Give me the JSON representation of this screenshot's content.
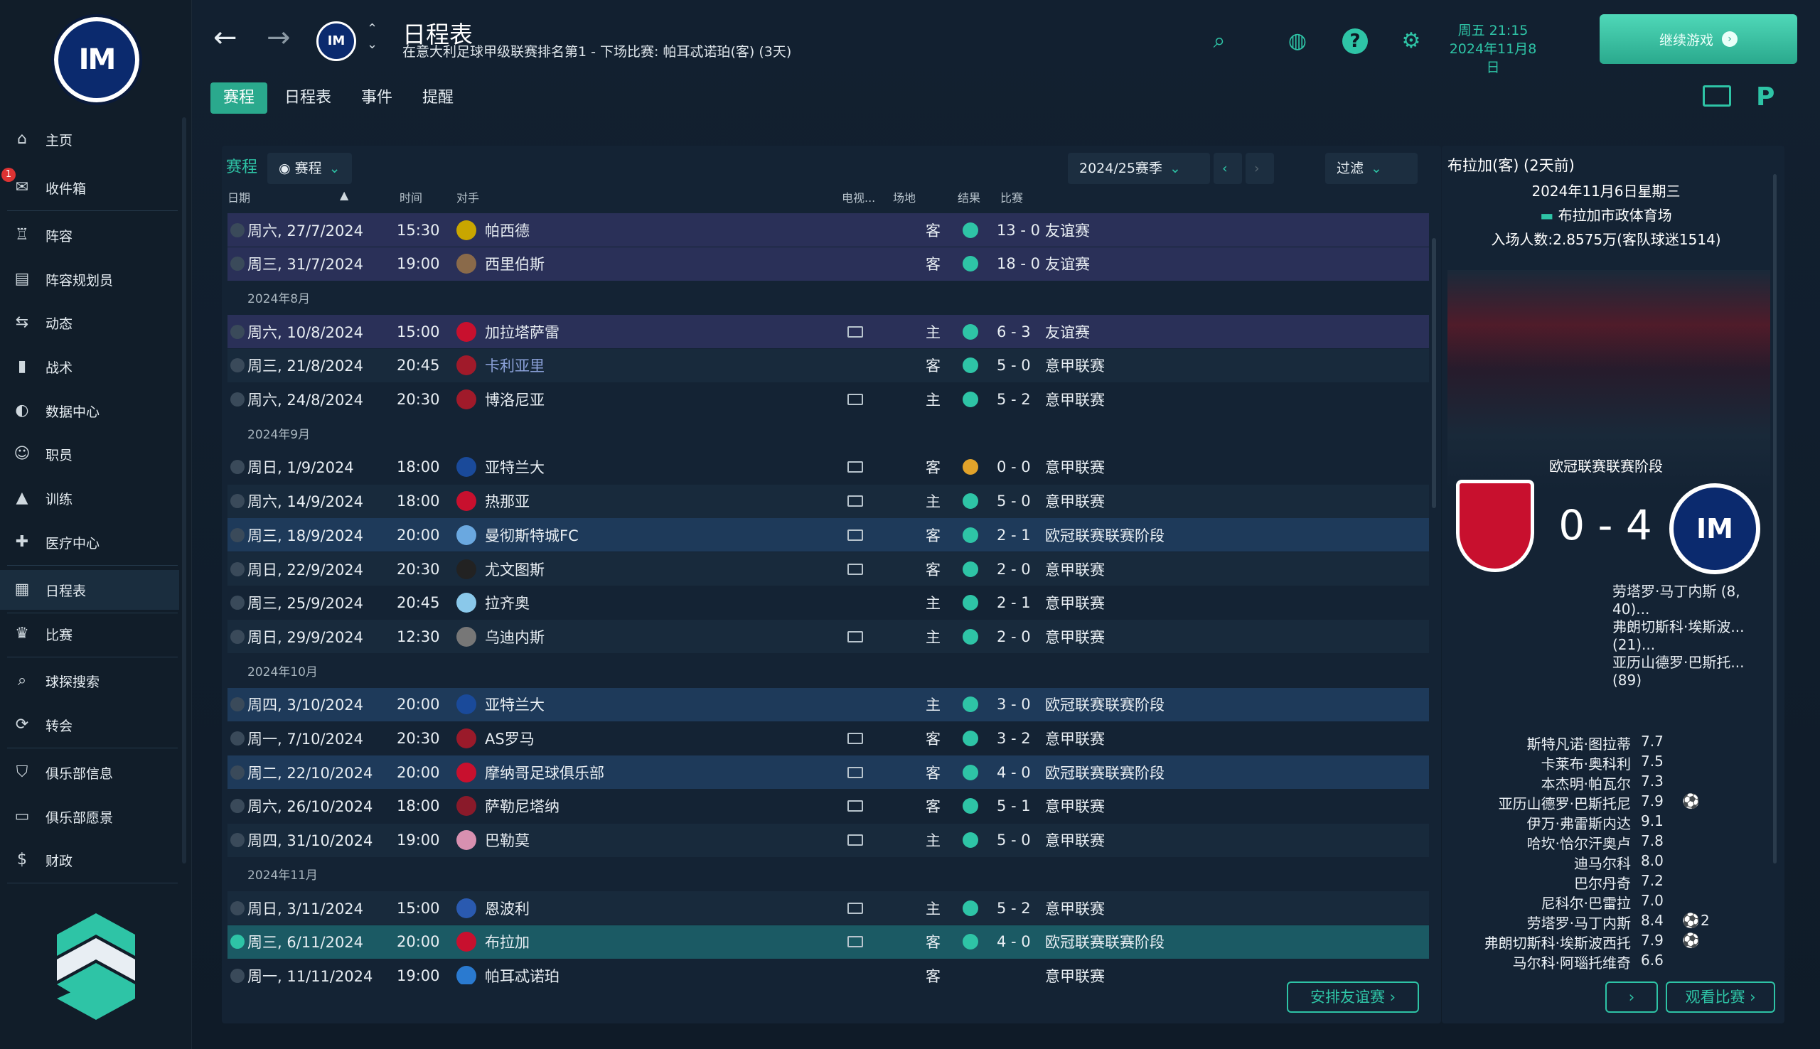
{
  "sidebar": {
    "items": [
      {
        "label": "主页",
        "icon": "home-icon"
      },
      {
        "label": "收件箱",
        "icon": "inbox-icon",
        "badge": "1"
      },
      {
        "label": "阵容",
        "icon": "shirt-icon"
      },
      {
        "label": "阵容规划员",
        "icon": "clipboard-icon"
      },
      {
        "label": "动态",
        "icon": "dynamics-icon"
      },
      {
        "label": "战术",
        "icon": "tactics-icon"
      },
      {
        "label": "数据中心",
        "icon": "data-hub-icon"
      },
      {
        "label": "职员",
        "icon": "staff-icon"
      },
      {
        "label": "训练",
        "icon": "training-icon"
      },
      {
        "label": "医疗中心",
        "icon": "medical-icon"
      },
      {
        "label": "日程表",
        "icon": "calendar-icon"
      },
      {
        "label": "比赛",
        "icon": "trophy-icon"
      },
      {
        "label": "球探搜索",
        "icon": "scouting-icon"
      },
      {
        "label": "转会",
        "icon": "transfers-icon"
      },
      {
        "label": "俱乐部信息",
        "icon": "club-info-icon"
      },
      {
        "label": "俱乐部愿景",
        "icon": "club-vision-icon"
      },
      {
        "label": "财政",
        "icon": "finances-icon"
      }
    ]
  },
  "header": {
    "title": "日程表",
    "subtitle": "在意大利足球甲级联赛排名第1 - 下场比赛: 帕耳忒诺珀(客) (3天)",
    "date_day": "周五 21:15",
    "date_full": "2024年11月8日",
    "continue_label": "继续游戏"
  },
  "tabs": [
    "赛程",
    "日程表",
    "事件",
    "提醒"
  ],
  "panel": {
    "title": "赛程",
    "view_dropdown": "赛程",
    "season": "2024/25赛季",
    "filter": "过滤",
    "columns": {
      "date": "日期",
      "time": "时间",
      "opponent": "对手",
      "tv": "电视...",
      "venue": "场地",
      "result": "结果",
      "competition": "比赛"
    },
    "arrange_friendly": "安排友谊赛"
  },
  "fixtures": [
    {
      "type": "match",
      "date": "周六, 27/7/2024",
      "time": "15:30",
      "opp": "帕西德",
      "tv": false,
      "venue": "客",
      "res": "w",
      "score": "13 - 0",
      "comp": "友谊赛",
      "style": "hl1",
      "color": "#c9a600"
    },
    {
      "type": "match",
      "date": "周三, 31/7/2024",
      "time": "19:00",
      "opp": "西里伯斯",
      "tv": false,
      "venue": "客",
      "res": "w",
      "score": "18 - 0",
      "comp": "友谊赛",
      "style": "hl1",
      "color": "#8a6a4a"
    },
    {
      "type": "month",
      "label": "2024年8月"
    },
    {
      "type": "match",
      "date": "周六, 10/8/2024",
      "time": "15:00",
      "opp": "加拉塔萨雷",
      "tv": true,
      "venue": "主",
      "res": "w",
      "score": "6 - 3",
      "comp": "友谊赛",
      "style": "hl1",
      "color": "#c8102e"
    },
    {
      "type": "match",
      "date": "周三, 21/8/2024",
      "time": "20:45",
      "opp": "卡利亚里",
      "tv": false,
      "venue": "客",
      "res": "w",
      "score": "5 - 0",
      "comp": "意甲联赛",
      "style": "alt",
      "color": "#a01a2a",
      "link": true
    },
    {
      "type": "match",
      "date": "周六, 24/8/2024",
      "time": "20:30",
      "opp": "博洛尼亚",
      "tv": true,
      "venue": "主",
      "res": "w",
      "score": "5 - 2",
      "comp": "意甲联赛",
      "style": "",
      "color": "#a01a2a"
    },
    {
      "type": "month",
      "label": "2024年9月"
    },
    {
      "type": "match",
      "date": "周日, 1/9/2024",
      "time": "18:00",
      "opp": "亚特兰大",
      "tv": true,
      "venue": "客",
      "res": "d",
      "score": "0 - 0",
      "comp": "意甲联赛",
      "style": "",
      "color": "#1a4a9a"
    },
    {
      "type": "match",
      "date": "周六, 14/9/2024",
      "time": "18:00",
      "opp": "热那亚",
      "tv": true,
      "venue": "主",
      "res": "w",
      "score": "5 - 0",
      "comp": "意甲联赛",
      "style": "alt",
      "color": "#c8102e"
    },
    {
      "type": "match",
      "date": "周三, 18/9/2024",
      "time": "20:00",
      "opp": "曼彻斯特城FC",
      "tv": true,
      "venue": "客",
      "res": "w",
      "score": "2 - 1",
      "comp": "欧冠联赛联赛阶段",
      "style": "hl2",
      "color": "#6aa8e0"
    },
    {
      "type": "match",
      "date": "周日, 22/9/2024",
      "time": "20:30",
      "opp": "尤文图斯",
      "tv": true,
      "venue": "客",
      "res": "w",
      "score": "2 - 0",
      "comp": "意甲联赛",
      "style": "alt",
      "color": "#222222"
    },
    {
      "type": "match",
      "date": "周三, 25/9/2024",
      "time": "20:45",
      "opp": "拉齐奥",
      "tv": false,
      "venue": "主",
      "res": "w",
      "score": "2 - 1",
      "comp": "意甲联赛",
      "style": "",
      "color": "#8ac8ea"
    },
    {
      "type": "match",
      "date": "周日, 29/9/2024",
      "time": "12:30",
      "opp": "乌迪内斯",
      "tv": true,
      "venue": "主",
      "res": "w",
      "score": "2 - 0",
      "comp": "意甲联赛",
      "style": "alt",
      "color": "#777777"
    },
    {
      "type": "month",
      "label": "2024年10月"
    },
    {
      "type": "match",
      "date": "周四, 3/10/2024",
      "time": "20:00",
      "opp": "亚特兰大",
      "tv": false,
      "venue": "主",
      "res": "w",
      "score": "3 - 0",
      "comp": "欧冠联赛联赛阶段",
      "style": "hl2",
      "color": "#1a4a9a"
    },
    {
      "type": "match",
      "date": "周一, 7/10/2024",
      "time": "20:30",
      "opp": "AS罗马",
      "tv": true,
      "venue": "客",
      "res": "w",
      "score": "3 - 2",
      "comp": "意甲联赛",
      "style": "",
      "color": "#9a1a2a"
    },
    {
      "type": "match",
      "date": "周二, 22/10/2024",
      "time": "20:00",
      "opp": "摩纳哥足球俱乐部",
      "tv": true,
      "venue": "客",
      "res": "w",
      "score": "4 - 0",
      "comp": "欧冠联赛联赛阶段",
      "style": "hl2",
      "color": "#c8102e"
    },
    {
      "type": "match",
      "date": "周六, 26/10/2024",
      "time": "18:00",
      "opp": "萨勒尼塔纳",
      "tv": true,
      "venue": "客",
      "res": "w",
      "score": "5 - 1",
      "comp": "意甲联赛",
      "style": "",
      "color": "#8a1a2a"
    },
    {
      "type": "match",
      "date": "周四, 31/10/2024",
      "time": "19:00",
      "opp": "巴勒莫",
      "tv": true,
      "venue": "主",
      "res": "w",
      "score": "5 - 0",
      "comp": "意甲联赛",
      "style": "alt",
      "color": "#d890b0"
    },
    {
      "type": "month",
      "label": "2024年11月"
    },
    {
      "type": "match",
      "date": "周日, 3/11/2024",
      "time": "15:00",
      "opp": "恩波利",
      "tv": true,
      "venue": "主",
      "res": "w",
      "score": "5 - 2",
      "comp": "意甲联赛",
      "style": "alt",
      "color": "#2a5ab0"
    },
    {
      "type": "match",
      "date": "周三, 6/11/2024",
      "time": "20:00",
      "opp": "布拉加",
      "tv": true,
      "venue": "客",
      "res": "w",
      "score": "4 - 0",
      "comp": "欧冠联赛联赛阶段",
      "style": "hl3",
      "color": "#c8102e",
      "checked": true
    },
    {
      "type": "match",
      "date": "周一, 11/11/2024",
      "time": "19:00",
      "opp": "帕耳忒诺珀",
      "tv": false,
      "venue": "客",
      "res": "",
      "score": "",
      "comp": "意甲联赛",
      "style": "",
      "color": "#2a7ad0"
    }
  ],
  "match_panel": {
    "title": "布拉加(客) (2天前)",
    "date": "2024年11月6日星期三",
    "stadium": "布拉加市政体育场",
    "attendance": "入场人数:2.8575万(客队球迷1514)",
    "competition": "欧冠联赛联赛阶段",
    "score": "0 - 4",
    "scorers": [
      "劳塔罗·马丁内斯 (8, 40)...",
      "弗朗切斯科·埃斯波... (21)...",
      "亚历山德罗·巴斯托... (89)"
    ],
    "ratings": [
      {
        "name": "斯特凡诺·图拉蒂",
        "val": "7.7"
      },
      {
        "name": "卡莱布·奥科利",
        "val": "7.5"
      },
      {
        "name": "本杰明·帕瓦尔",
        "val": "7.3"
      },
      {
        "name": "亚历山德罗·巴斯托尼",
        "val": "7.9",
        "ball": true,
        "goals": ""
      },
      {
        "name": "伊万·弗雷斯内达",
        "val": "9.1"
      },
      {
        "name": "哈坎·恰尔汗奥卢",
        "val": "7.8"
      },
      {
        "name": "迪马尔科",
        "val": "8.0"
      },
      {
        "name": "巴尔丹奇",
        "val": "7.2"
      },
      {
        "name": "尼科尔·巴雷拉",
        "val": "7.0"
      },
      {
        "name": "劳塔罗·马丁内斯",
        "val": "8.4",
        "ball": true,
        "goals": "2"
      },
      {
        "name": "弗朗切斯科·埃斯波西托",
        "val": "7.9",
        "ball": true,
        "goals": ""
      },
      {
        "name": "马尔科·阿瑙托维奇",
        "val": "6.6"
      }
    ],
    "next_label": "›",
    "watch_label": "观看比赛"
  },
  "colors": {
    "accent": "#2ec4a6",
    "win": "#2ec4a6",
    "draw": "#e2a32a"
  }
}
